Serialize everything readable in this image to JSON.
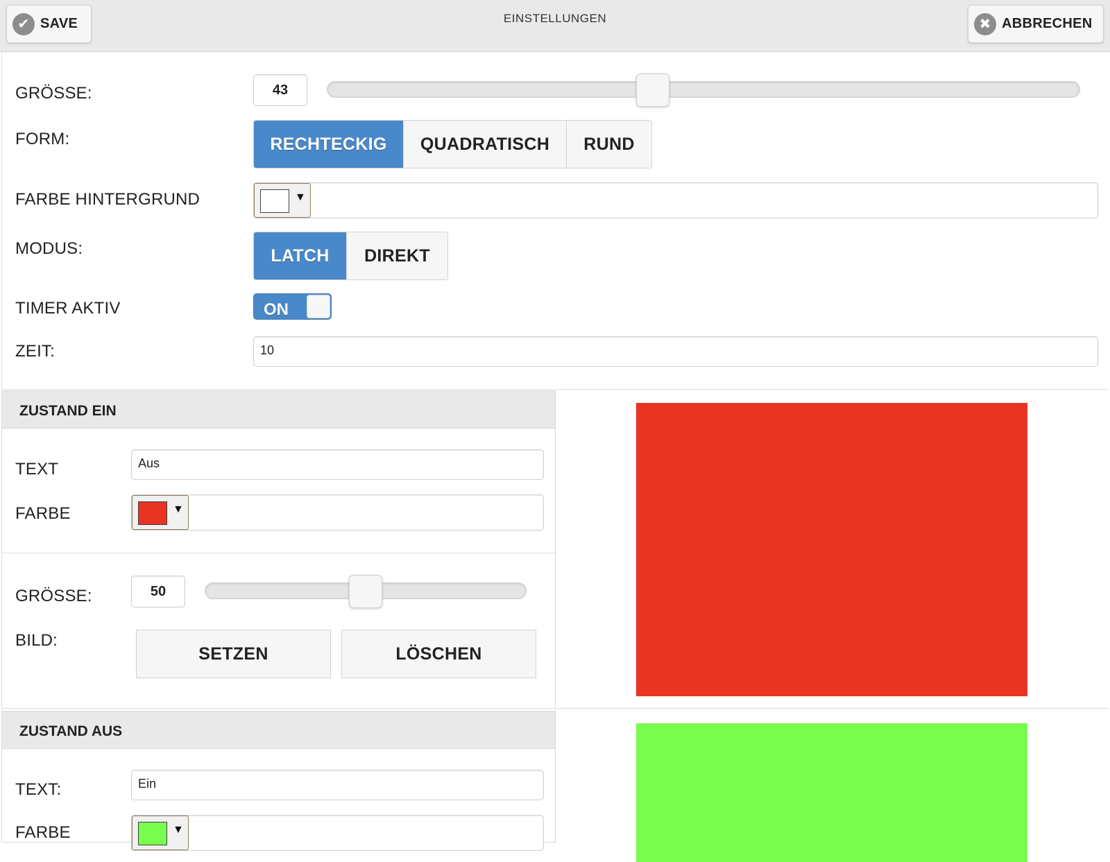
{
  "header": {
    "title": "EINSTELLUNGEN",
    "save_label": "SAVE",
    "cancel_label": "ABBRECHEN"
  },
  "settings": {
    "size_label": "GRÖSSE:",
    "size_value": "43",
    "size_slider_fraction": 0.43,
    "form_label": "FORM:",
    "form_options": [
      "RECHTECKIG",
      "QUADRATISCH",
      "RUND"
    ],
    "form_selected": "RECHTECKIG",
    "bg_color_label": "FARBE HINTERGRUND",
    "bg_color": "#ffffff",
    "mode_label": "MODUS:",
    "mode_options": [
      "LATCH",
      "DIREKT"
    ],
    "mode_selected": "LATCH",
    "timer_label": "TIMER AKTIV",
    "timer_state": "ON",
    "time_label": "ZEIT:",
    "time_value": "10"
  },
  "state_on": {
    "header": "ZUSTAND EIN",
    "text_label": "TEXT",
    "text_value": "Aus",
    "color_label": "FARBE",
    "color": "#e93323",
    "size_label": "GRÖSSE:",
    "size_value": "50",
    "size_slider_fraction": 0.5,
    "image_label": "BILD:",
    "set_label": "SETZEN",
    "delete_label": "LÖSCHEN"
  },
  "state_off": {
    "header": "ZUSTAND AUS",
    "text_label": "TEXT:",
    "text_value": "Ein",
    "color_label": "FARBE",
    "color": "#78fd4f"
  },
  "colors": {
    "accent": "#4a89c9",
    "header_bg": "#e9e9e9"
  }
}
